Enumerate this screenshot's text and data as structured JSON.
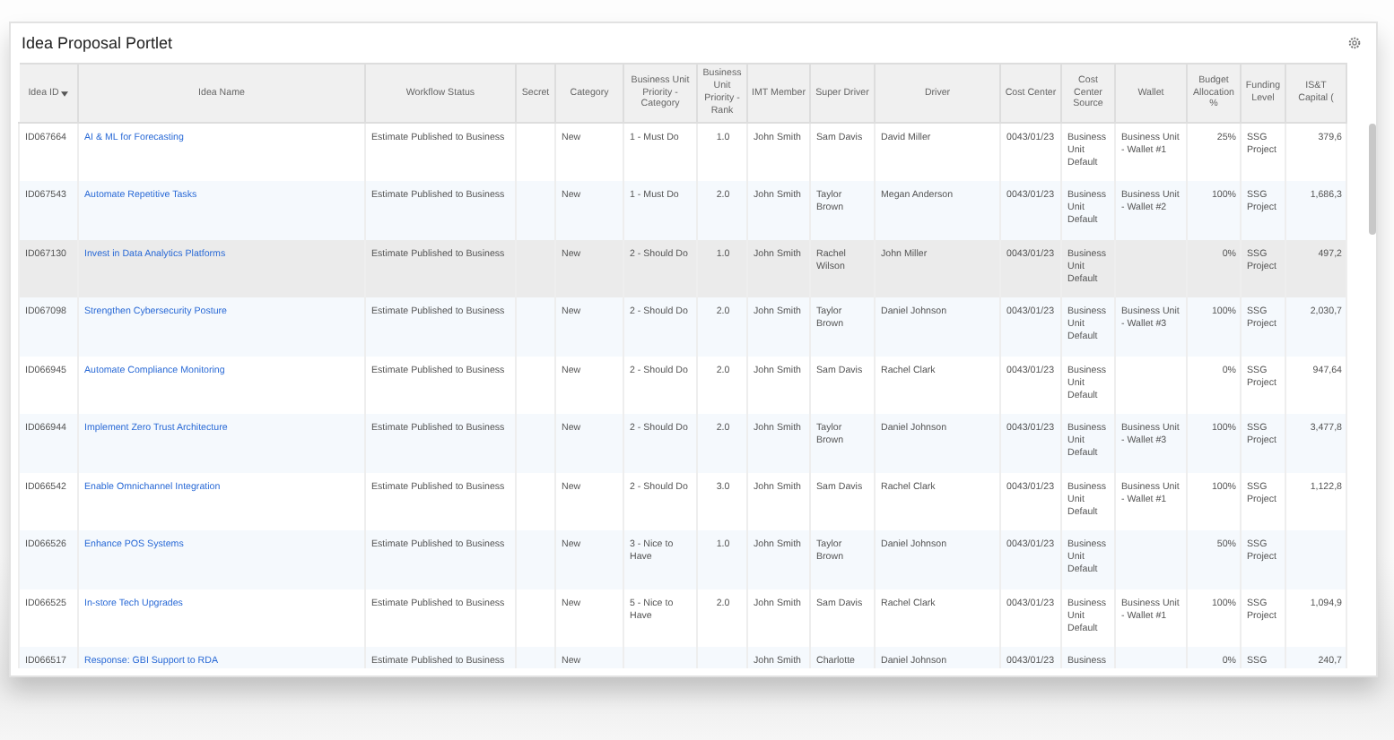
{
  "portlet": {
    "title": "Idea Proposal Portlet"
  },
  "table": {
    "columns": [
      {
        "label": "Idea ID",
        "kind": "text",
        "sorted": true
      },
      {
        "label": "Idea Name",
        "kind": "link",
        "sorted": false
      },
      {
        "label": "Workflow Status",
        "kind": "text",
        "sorted": false
      },
      {
        "label": "Secret",
        "kind": "text",
        "sorted": false
      },
      {
        "label": "Category",
        "kind": "text",
        "sorted": false
      },
      {
        "label": "Business Unit Priority - Category",
        "kind": "text",
        "sorted": false
      },
      {
        "label": "Business Unit Priority - Rank",
        "kind": "rank",
        "sorted": false
      },
      {
        "label": "IMT Member",
        "kind": "text",
        "sorted": false
      },
      {
        "label": "Super Driver",
        "kind": "text",
        "sorted": false
      },
      {
        "label": "Driver",
        "kind": "text",
        "sorted": false
      },
      {
        "label": "Cost Center",
        "kind": "text",
        "sorted": false
      },
      {
        "label": "Cost Center Source",
        "kind": "text",
        "sorted": false
      },
      {
        "label": "Wallet",
        "kind": "text",
        "sorted": false
      },
      {
        "label": "Budget Allocation %",
        "kind": "number",
        "sorted": false
      },
      {
        "label": "Funding Level",
        "kind": "text",
        "sorted": false
      },
      {
        "label": "IS&T Capital (",
        "kind": "number",
        "sorted": false
      }
    ],
    "rows": [
      {
        "hovered": false,
        "idea_id": "ID067664",
        "idea_name": "AI & ML for Forecasting",
        "workflow_status": "Estimate Published to Business",
        "category": "New",
        "bu_priority_category": "1 - Must Do",
        "bu_priority_rank": "1.0",
        "imt_member": "John Smith",
        "super_driver": "Sam Davis",
        "driver": "David Miller",
        "cost_center": "0043/01/23",
        "cost_center_source": "Business Unit Default",
        "wallet": "Business Unit - Wallet #1",
        "budget_allocation": "25%",
        "funding_level": "SSG Project",
        "ist_capital": "379,6"
      },
      {
        "hovered": false,
        "idea_id": "ID067543",
        "idea_name": "Automate Repetitive Tasks",
        "workflow_status": "Estimate Published to Business",
        "category": "New",
        "bu_priority_category": "1 - Must Do",
        "bu_priority_rank": "2.0",
        "imt_member": "John Smith",
        "super_driver": "Taylor Brown",
        "driver": "Megan Anderson",
        "cost_center": "0043/01/23",
        "cost_center_source": "Business Unit Default",
        "wallet": "Business Unit - Wallet #2",
        "budget_allocation": "100%",
        "funding_level": "SSG Project",
        "ist_capital": "1,686,3"
      },
      {
        "hovered": true,
        "idea_id": "ID067130",
        "idea_name": "Invest in Data Analytics Platforms",
        "workflow_status": "Estimate Published to Business",
        "category": "New",
        "bu_priority_category": "2 - Should Do",
        "bu_priority_rank": "1.0",
        "imt_member": "John Smith",
        "super_driver": "Rachel Wilson",
        "driver": "John Miller",
        "cost_center": "0043/01/23",
        "cost_center_source": "Business Unit Default",
        "budget_allocation": "0%",
        "funding_level": "SSG Project",
        "ist_capital": "497,2"
      },
      {
        "hovered": false,
        "idea_id": "ID067098",
        "idea_name": "Strengthen Cybersecurity Posture",
        "workflow_status": "Estimate Published to Business",
        "category": "New",
        "bu_priority_category": "2 - Should Do",
        "bu_priority_rank": "2.0",
        "imt_member": "John Smith",
        "super_driver": "Taylor Brown",
        "driver": "Daniel Johnson",
        "cost_center": "0043/01/23",
        "cost_center_source": "Business Unit Default",
        "wallet": "Business Unit - Wallet #3",
        "budget_allocation": "100%",
        "funding_level": "SSG Project",
        "ist_capital": "2,030,7"
      },
      {
        "hovered": false,
        "idea_id": "ID066945",
        "idea_name": "Automate Compliance Monitoring",
        "workflow_status": "Estimate Published to Business",
        "category": "New",
        "bu_priority_category": "2 - Should Do",
        "bu_priority_rank": "2.0",
        "imt_member": "John Smith",
        "super_driver": "Sam Davis",
        "driver": "Rachel Clark",
        "cost_center": "0043/01/23",
        "cost_center_source": "Business Unit Default",
        "budget_allocation": "0%",
        "funding_level": "SSG Project",
        "ist_capital": "947,64"
      },
      {
        "hovered": false,
        "idea_id": "ID066944",
        "idea_name": "Implement Zero Trust Architecture",
        "workflow_status": "Estimate Published to Business",
        "category": "New",
        "bu_priority_category": "2 - Should Do",
        "bu_priority_rank": "2.0",
        "imt_member": "John Smith",
        "super_driver": "Taylor Brown",
        "driver": "Daniel Johnson",
        "cost_center": "0043/01/23",
        "cost_center_source": "Business Unit Default",
        "wallet": "Business Unit - Wallet #3",
        "budget_allocation": "100%",
        "funding_level": "SSG Project",
        "ist_capital": "3,477,8"
      },
      {
        "hovered": false,
        "idea_id": "ID066542",
        "idea_name": "Enable Omnichannel Integration",
        "workflow_status": "Estimate Published to Business",
        "category": "New",
        "bu_priority_category": "2 - Should Do",
        "bu_priority_rank": "3.0",
        "imt_member": "John Smith",
        "super_driver": "Sam Davis",
        "driver": "Rachel Clark",
        "cost_center": "0043/01/23",
        "cost_center_source": "Business Unit Default",
        "wallet": "Business Unit - Wallet #1",
        "budget_allocation": "100%",
        "funding_level": "SSG Project",
        "ist_capital": "1,122,8"
      },
      {
        "hovered": false,
        "idea_id": "ID066526",
        "idea_name": "Enhance POS Systems",
        "workflow_status": "Estimate Published to Business",
        "category": "New",
        "bu_priority_category": "3 - Nice to Have",
        "bu_priority_rank": "1.0",
        "imt_member": "John Smith",
        "super_driver": "Taylor Brown",
        "driver": "Daniel Johnson",
        "cost_center": "0043/01/23",
        "cost_center_source": "Business Unit Default",
        "budget_allocation": "50%",
        "funding_level": "SSG Project"
      },
      {
        "hovered": false,
        "idea_id": "ID066525",
        "idea_name": "In-store Tech Upgrades",
        "workflow_status": "Estimate Published to Business",
        "category": "New",
        "bu_priority_category": "5 - Nice to Have",
        "bu_priority_rank": "2.0",
        "imt_member": "John Smith",
        "super_driver": "Sam Davis",
        "driver": "Rachel Clark",
        "cost_center": "0043/01/23",
        "cost_center_source": "Business Unit Default",
        "wallet": "Business Unit - Wallet #1",
        "budget_allocation": "100%",
        "funding_level": "SSG Project",
        "ist_capital": "1,094,9"
      },
      {
        "hovered": false,
        "idea_id": "ID066517",
        "idea_name": "Response: GBI Support to RDA",
        "workflow_status": "Estimate Published to Business",
        "category": "New",
        "imt_member": "John Smith",
        "super_driver": "Charlotte",
        "driver": "Daniel Johnson",
        "cost_center": "0043/01/23",
        "cost_center_source": "Business",
        "budget_allocation": "0%",
        "funding_level": "SSG",
        "ist_capital": "240,7"
      }
    ]
  }
}
